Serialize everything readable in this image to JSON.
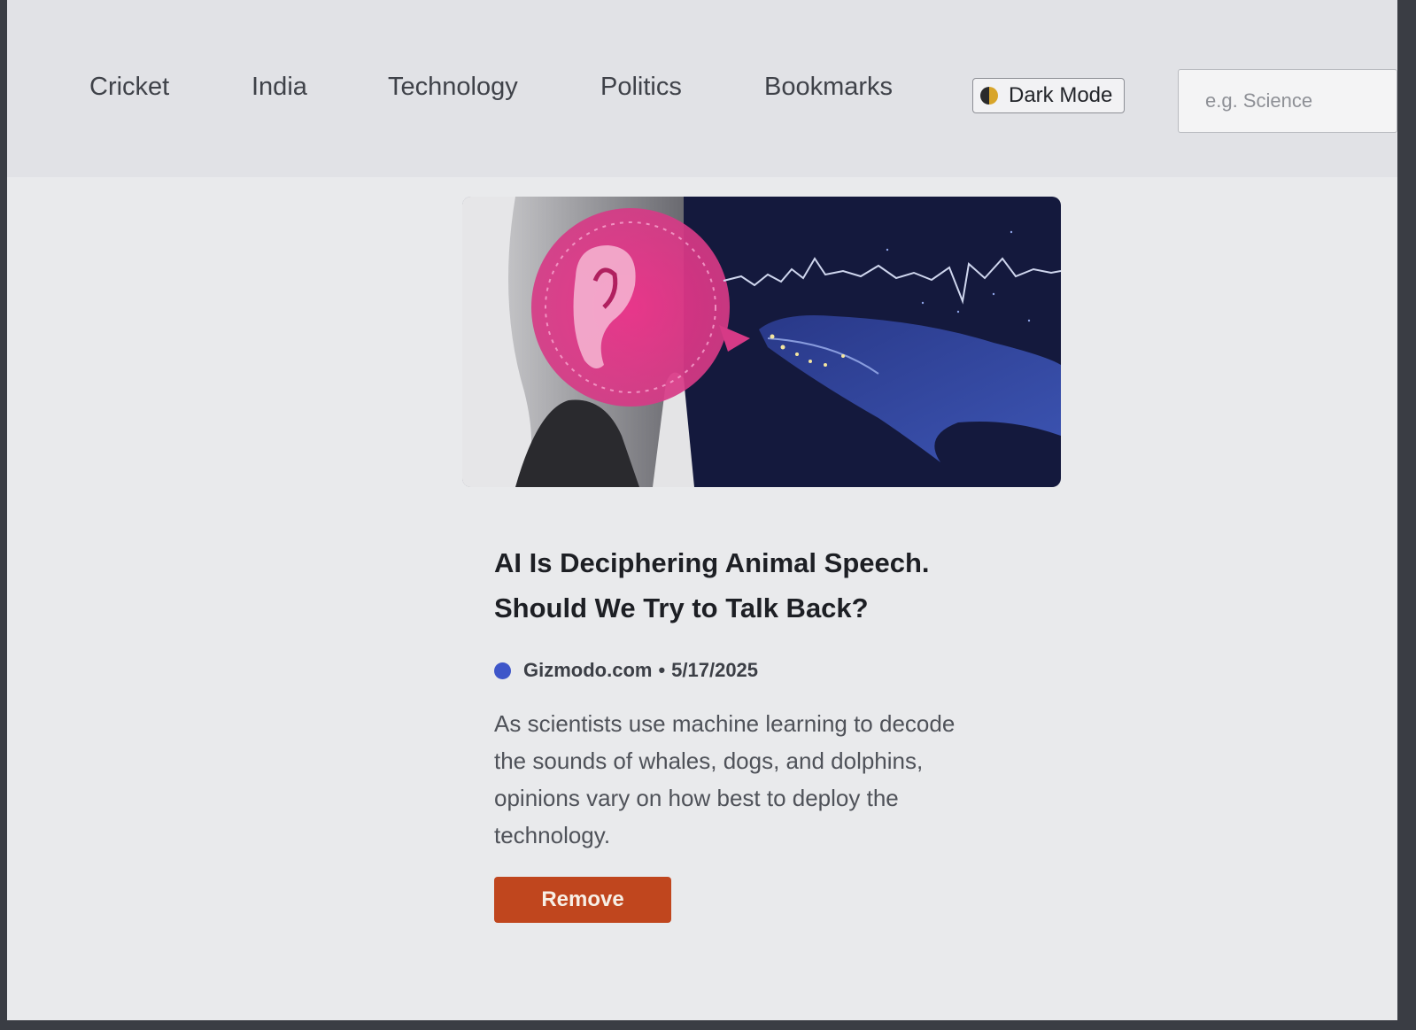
{
  "nav": {
    "links": [
      "Cricket",
      "India",
      "Technology",
      "Politics",
      "Bookmarks"
    ]
  },
  "theme_toggle": {
    "icon": "half-moon-icon",
    "label": "Dark Mode"
  },
  "search": {
    "placeholder": "e.g. Science",
    "value": ""
  },
  "article": {
    "image_description": "pink-and-navy illustration: ear with sound bubble facing a whale with a waveform",
    "title": "AI Is Deciphering Animal Speech. Should We Try to Talk Back?",
    "source": "Gizmodo.com",
    "date": "5/17/2025",
    "separator": "•",
    "description": "As scientists use machine learning to decode the sounds of whales, dogs, and dolphins, opinions vary on how best to deploy the technology.",
    "remove_label": "Remove"
  },
  "colors": {
    "page_background": "#e9eaec",
    "navbar_background": "#e1e2e6",
    "remove_button": "#c0461e",
    "source_dot": "#3e56c9",
    "hero_pink": "#e0407f",
    "hero_navy": "#14193d"
  }
}
